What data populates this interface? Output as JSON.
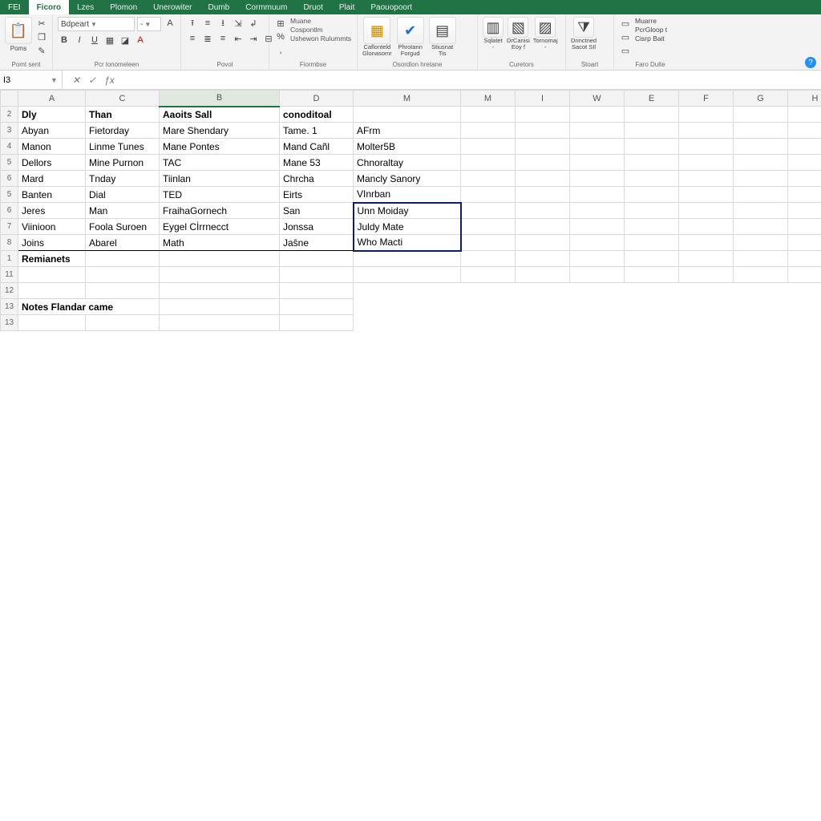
{
  "tabs": [
    "FEI",
    "Ficoro",
    "Lzes",
    "Plomon",
    "Unerowiter",
    "Dumb",
    "Cormmuum",
    "Druot",
    "Plait",
    "Paouopoort"
  ],
  "active_tab_index": 1,
  "ribbon": {
    "groups": {
      "clipboard": {
        "paste": "Poms",
        "label": "Pomt sent"
      },
      "font": {
        "name": "Bdpeart",
        "size": "-",
        "label": "Pcr lonomeleen"
      },
      "alignment": {
        "label": "Povol"
      },
      "number": {
        "l1": "Muane",
        "l2": "Cospontlm",
        "l3": "Ushewon Rulummts",
        "label": "Fiormbse"
      },
      "styles": {
        "b1_top": "Caflonteld",
        "b1_bot": "Glonasomr",
        "b2_top": "Phrotann",
        "b2_bot": "Forgud",
        "b3_top": "Stiusnat",
        "b3_bot": "Tis",
        "label": "Osordlon hretane"
      },
      "cells": {
        "c1_top": "Sqlatet",
        "c1_bot": "-",
        "c2_top": "DrCanisi",
        "c2_bot": "Eoy f",
        "c3_top": "Tornomaj",
        "c3_bot": "-",
        "label": "Curetors"
      },
      "editing": {
        "e1_top": "Dnnctned",
        "e1_bot": "Sacot SIl",
        "label": "Stoart"
      },
      "extra": {
        "x1": "Muarre",
        "x2": "PcrGloop t",
        "x3": "Cisrp Bait",
        "label": "Faro Dulte"
      }
    }
  },
  "namebox": "I3",
  "col_headers": [
    "A",
    "C",
    "B",
    "D",
    "M",
    "M",
    "I",
    "W",
    "E",
    "F",
    "G",
    "H"
  ],
  "row_nums_top": [
    "2",
    "3",
    "4",
    "5",
    "6",
    "5",
    "6",
    "7",
    "8",
    "1",
    "11",
    "12",
    "13",
    "13"
  ],
  "sheet": {
    "headers": {
      "A": "Dly",
      "C": "Than",
      "B": "Aaoits Sall",
      "D": "conoditoal"
    },
    "rows": [
      {
        "A": "Abyan",
        "C": "Fietorday",
        "B": "Mare Shendary",
        "D": "Tame. 1",
        "M": "AFrm"
      },
      {
        "A": "Manon",
        "C": "Linme Tunes",
        "B": "Mane Pontes",
        "D": "Mand Cañl",
        "M": "Molter5B"
      },
      {
        "A": "Dellors",
        "C": "Mine Purnon",
        "B": "TAC",
        "D": "Mane 53",
        "M": "Chnoraltay"
      },
      {
        "A": "Mard",
        "C": "Tnday",
        "B": "Tiinlan",
        "D": "Chrcha",
        "M": "Mancly Sanory"
      },
      {
        "A": "Banten",
        "C": "Dial",
        "B": "TED",
        "D": "Eirts",
        "M": "VInrban"
      },
      {
        "A": "Jeres",
        "C": "Man",
        "B": "FraihaGornech",
        "D": "San",
        "M": "Unn Moiday"
      },
      {
        "A": "Viinioon",
        "C": "Foola Suroen",
        "B": "Eygel Cİrrnecct",
        "D": "Jonssa",
        "M": "Juldy Mate"
      },
      {
        "A": "Joins",
        "C": "Abarel",
        "B": "Math",
        "D": "Jaŝne",
        "M": "Who Macti"
      }
    ],
    "label_reminders": "Remianets",
    "label_notes": "Notes Flandar came"
  },
  "colors": {
    "excel_green": "#217346",
    "red_text": "#cc2a1f",
    "navy": "#0a1f6b"
  }
}
